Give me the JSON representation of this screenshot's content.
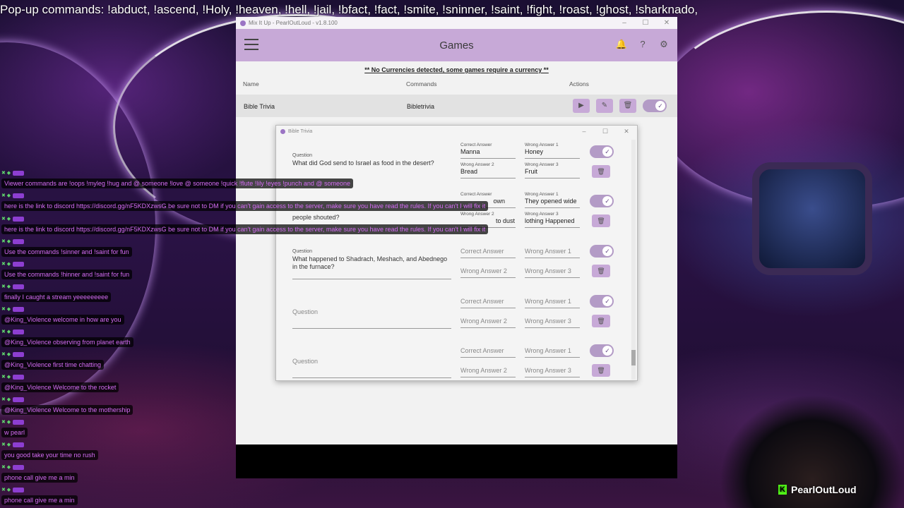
{
  "overlay": {
    "popup_commands": "Pop-up commands: !abduct, !ascend, !Holy, !heaven, !hell,  !jail, !bfact, !fact, !smite, !sninner, !saint, !fight, !roast, !ghost, !sharknado,",
    "streamer_brand": "PearlOutLoud",
    "brand_color": "#53fc18"
  },
  "chat": {
    "messages": [
      {
        "text": "Viewer commands are !oops !myleg !hug and @ someone !love @ someone !quick !flute !lily !eyes !punch and @ someone"
      },
      {
        "text": "here is the link to discord https://discord.gg/nF5KDXzwsG be sure not to DM if you can't gain access to the server, make sure you have read the rules. If you can't I will fix it"
      },
      {
        "text": "here is the link to discord https://discord.gg/nF5KDXzwsG be sure not to DM if you can't gain access to the server, make sure you have read the rules. If you can't I will fix it"
      },
      {
        "text": "Use the commands !sinner and !saint for fun"
      },
      {
        "text": "Use the commands !hinner and !saint for fun"
      },
      {
        "text": "finally I caught a stream yeeeeeeeee"
      },
      {
        "text": "@King_Violence welcome in how are you"
      },
      {
        "text": "@King_Violence observing from planet earth"
      },
      {
        "text": "@King_Violence first time chatting"
      },
      {
        "text": "@King_Violence Welcome to the rocket"
      },
      {
        "text": "@King_Violence Welcome to the mothership"
      },
      {
        "text": "w pearl"
      },
      {
        "text": "you good take your time no rush"
      },
      {
        "text": "phone call give me a min"
      },
      {
        "text": "phone call give me a min"
      }
    ]
  },
  "app": {
    "window_title": "Mix It Up - PearlOutLoud - v1.8.100",
    "page_title": "Games",
    "notice": "** No Currencies detected, some games require a currency **",
    "columns": {
      "name": "Name",
      "commands": "Commands",
      "actions": "Actions"
    },
    "games": [
      {
        "name": "Bible Trivia",
        "command": "Bibletrivia",
        "enabled": true
      }
    ],
    "accent_color": "#c7a9d7"
  },
  "dialog": {
    "title": "Bible Trivia",
    "labels": {
      "question": "Question",
      "correct": "Correct Answer",
      "wrong1": "Wrong Answer 1",
      "wrong2": "Wrong Answer 2",
      "wrong3": "Wrong Answer 3"
    },
    "questions": [
      {
        "question": "What did God send to Israel as food in the desert?",
        "correct": "Manna",
        "wrong1": "Honey",
        "wrong2": "Bread",
        "wrong3": "Fruit",
        "enabled": true
      },
      {
        "question": "people shouted?",
        "correct": "own",
        "wrong1": "They opened wide",
        "wrong2": "to dust",
        "wrong3": "lothing Happened",
        "enabled": true
      },
      {
        "question": "What happened to Shadrach, Meshach, and Abednego in the furnace?",
        "correct": "",
        "wrong1": "",
        "wrong2": "",
        "wrong3": "",
        "enabled": true
      },
      {
        "question": "",
        "correct": "",
        "wrong1": "",
        "wrong2": "",
        "wrong3": "",
        "enabled": true
      },
      {
        "question": "",
        "correct": "",
        "wrong1": "",
        "wrong2": "",
        "wrong3": "",
        "enabled": true
      }
    ]
  }
}
